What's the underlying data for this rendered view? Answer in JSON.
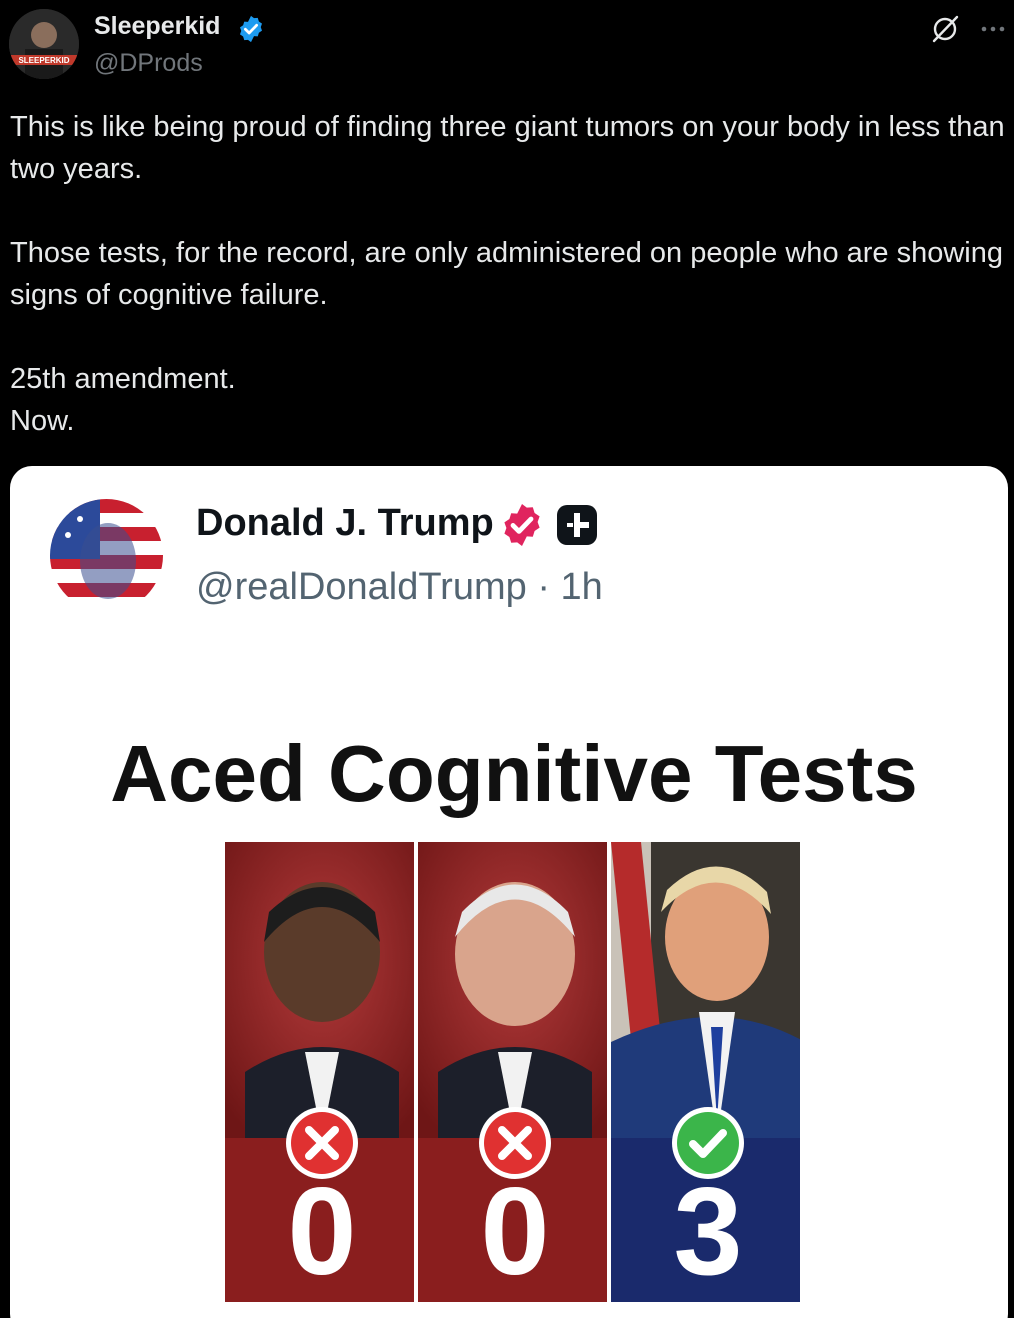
{
  "post": {
    "display_name": "Sleeperkid",
    "handle": "@DProds",
    "avatar_icon": "profile-avatar",
    "avatar_text": "SLEEPERKID",
    "text_lines": [
      "This is like being proud of finding three giant tumors on your body in less than two years.",
      "",
      "Those tests, for the record, are only administered on people who are showing signs of cognitive failure.",
      "",
      "25th amendment.",
      "Now."
    ]
  },
  "embedded": {
    "display_name": "Donald J. Trump",
    "handle": "@realDonaldTrump",
    "separator": "·",
    "time": "1h",
    "title": "Aced Cognitive Tests",
    "panels": [
      {
        "score": "0",
        "mark": "x-icon",
        "color": "#8a1e1e"
      },
      {
        "score": "0",
        "mark": "x-icon",
        "color": "#8a1e1e"
      },
      {
        "score": "3",
        "mark": "check-icon",
        "color": "#1a2a6c"
      }
    ]
  },
  "colors": {
    "background": "#000000",
    "verified_blue": "#1d9bf0",
    "verified_pink": "#e0245e",
    "card": "#ffffff"
  }
}
